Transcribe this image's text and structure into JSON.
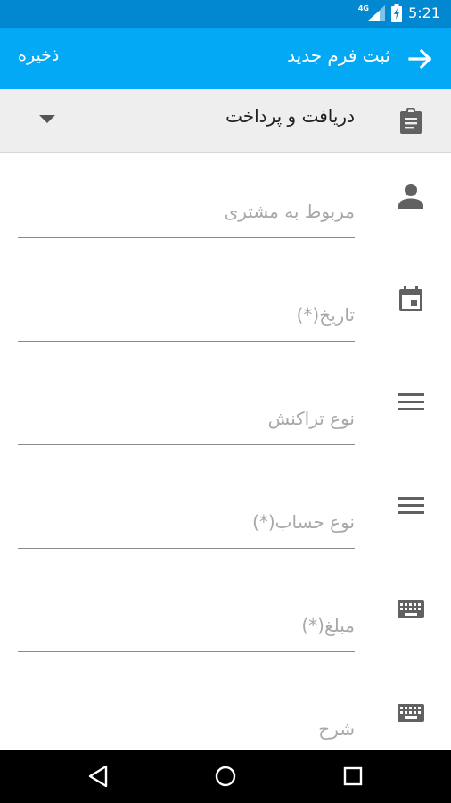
{
  "status_bar": {
    "network": "4G",
    "time": "5:21"
  },
  "app_bar": {
    "title": "ثبت فرم جدید",
    "save_label": "ذخیره"
  },
  "transaction_type": {
    "value": "دریافت و پرداخت"
  },
  "fields": [
    {
      "placeholder": "مربوط به مشتری",
      "icon": "person-icon"
    },
    {
      "placeholder": "تاریخ(*)",
      "icon": "calendar-icon"
    },
    {
      "placeholder": "نوع تراکنش",
      "icon": "menu-lines-icon"
    },
    {
      "placeholder": "نوع حساب(*)",
      "icon": "menu-lines-icon"
    },
    {
      "placeholder": "مبلغ(*)",
      "icon": "keyboard-icon"
    },
    {
      "placeholder": "شرح",
      "icon": "keyboard-icon"
    }
  ],
  "colors": {
    "status_bar": "#0288d1",
    "app_bar": "#03a9f4",
    "icon": "#616161",
    "placeholder": "#a8a8a8"
  }
}
